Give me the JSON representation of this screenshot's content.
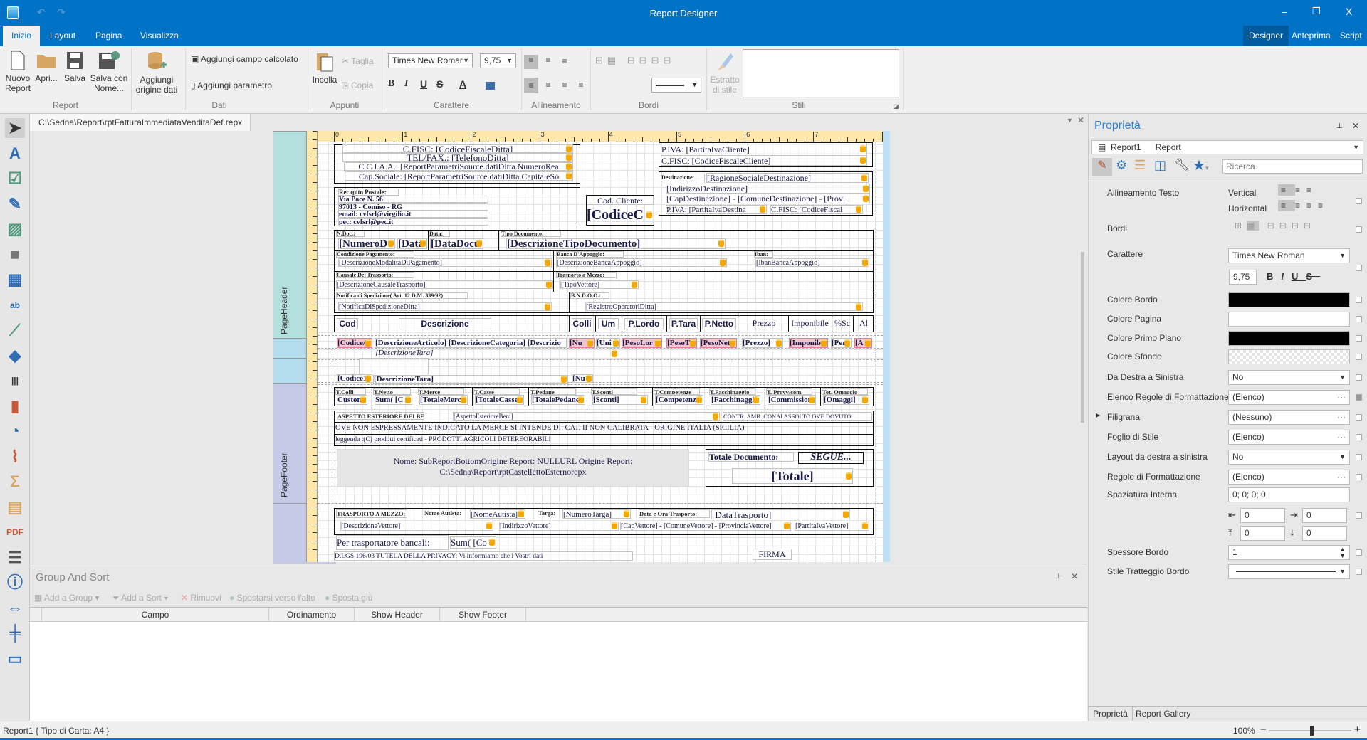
{
  "window": {
    "title": "Report Designer",
    "minimize": "–",
    "restore": "❐",
    "close": "X"
  },
  "ribbon_tabs": [
    {
      "label": "Inizio",
      "active": true
    },
    {
      "label": "Layout"
    },
    {
      "label": "Pagina"
    },
    {
      "label": "Visualizza"
    }
  ],
  "view_tabs": [
    {
      "label": "Designer",
      "active": true
    },
    {
      "label": "Anteprima"
    },
    {
      "label": "Script"
    }
  ],
  "ribbon": {
    "groups": [
      "Report",
      "Dati",
      "Appunti",
      "Carattere",
      "Allineamento",
      "Bordi",
      "Stili"
    ],
    "nuovo": "Nuovo Report",
    "apri": "Apri...",
    "salva": "Salva",
    "salva_con": "Salva con Nome...",
    "aggiungi_origine": "Aggiungi origine dati",
    "campo_calcolato": "Aggiungi campo calcolato",
    "parametro": "Aggiungi parametro",
    "incolla": "Incolla",
    "taglia": "Taglia",
    "copia": "Copia",
    "font": "Times New Romar",
    "size": "9,75",
    "bold": "B",
    "italic": "I",
    "underline": "U",
    "strike": "S",
    "forecolor": "A",
    "estratto": "Estratto di stile"
  },
  "document_tab": "C:\\Sedna\\Report\\rptFatturaImmediataVenditaDef.repx",
  "bands": {
    "page_header": "PageHeader",
    "page_footer": "PageFooter"
  },
  "ruler_marks": [
    "0",
    "1",
    "2",
    "3",
    "4",
    "5",
    "6",
    "7",
    "8"
  ],
  "report": {
    "h": {
      "cfisc": "C.FISC: [CodiceFiscaleDitta]",
      "tel": "TEL/FAX.: [TelefonoDitta]",
      "cciaa": "C.C.I.A.A.: [ReportParametriSource.datiDitta.NumeroRea",
      "capsoc": "Cap.Sociale: [ReportParametriSource.datiDitta.CapitaleSo",
      "recapito_label": "Recapito Postale:",
      "via": "Via Pace N. 56",
      "cap": "97013 - Comiso - RG",
      "email": "email: cvfsrl@virgilio.it",
      "pec": "pec: cvfsrl@pec.it",
      "codcli_label": "Cod. Cliente:",
      "codcli": "[CodiceC",
      "piva_cli": "P.IVA:  [PartitaIvaCliente]",
      "cfisc_cli": "C.FISC: [CodiceFiscaleCliente]",
      "dest_label": "Destinazione:",
      "dest_rag": "[RagioneSocialeDestinazione]",
      "dest_ind": "[IndirizzoDestinazione]",
      "dest_cap": "[CapDestinazione] - [ComuneDestinazione] - [Provi",
      "dest_piva": "P.IVA:  [PartitaIvaDestina",
      "dest_cf": "C.FISC: [CodiceFiscal"
    },
    "d": {
      "ndoc_label": "N.Doc.:",
      "ndoc": "[NumeroD",
      "data_a": "[Data",
      "data_label": "Data:",
      "data_b": "[DataDocu",
      "tipo_label": "Tipo Documento:",
      "tipo": "[DescrizioneTipoDocumento]",
      "cond_label": "Condizione Pagamento:",
      "cond": "[DescrizioneModalitaDiPagamento]",
      "banca_label": "Banca D'Appoggio:",
      "banca": "[DescrizioneBancaAppoggio]",
      "iban_label": "Iban:",
      "iban": "[IbanBancaAppoggio]",
      "causale_label": "Causale Del Trasporto:",
      "causale": "[DescrizioneCausaleTrasporto]",
      "tm_label": "Trasporto a Mezzo:",
      "tm": "[TipoVettore]",
      "notifica_label": "Notifica  di Spedizione( Art. 12 D.M. 339/92)",
      "notifica": "[NotificaDiSpedizioneDitta]",
      "bndoo_label": "B.N.D.O.O.:",
      "bndoo": "[RegistroOperatoriDitta]"
    },
    "columns": [
      "Cod",
      "Descrizione",
      "Colli",
      "Um",
      "P.Lordo",
      "P.Tara",
      "P.Netto",
      "Prezzo",
      "Imponibile",
      "%Sc",
      "Al"
    ],
    "detail": [
      "[Codice/",
      "[DescrizioneArticolo] [DescrizioneCategoria] [Descrizio",
      "[Nu",
      "[Uni",
      "[PesoLor",
      "[PesoT",
      "[PesoNet",
      "[Prezzo]",
      "[Imponib",
      "[Perc",
      "[A"
    ],
    "detail_tara": "[DescrizioneTara]",
    "detail2": [
      "[Codice1",
      "[DescrizioneTara]",
      "[Nu"
    ],
    "totals": [
      {
        "label": "T.Colli",
        "value": "Custom"
      },
      {
        "label": "T.Netto",
        "value": "Sum( [C"
      },
      {
        "label": "T.Merce",
        "value": "[TotaleMerce"
      },
      {
        "label": "T.Casse",
        "value": "[TotaleCasse"
      },
      {
        "label": "T.Pedane",
        "value": "[TotalePedane"
      },
      {
        "label": "T.Sconti",
        "value": "[Sconti]"
      },
      {
        "label": "T.Competenze",
        "value": "[Competenze"
      },
      {
        "label": "T.Facchinaggio",
        "value": "[Facchinaggio"
      },
      {
        "label": "T. Provv/com.",
        "value": "[Commission"
      },
      {
        "label": "Tot. Omaggio",
        "value": "[Omaggi]"
      }
    ],
    "f": {
      "aspetto_label": "ASPETTO ESTERIORE DEI BENI:",
      "aspetto": "[AspettoEsterioreBeni]",
      "conai": "CONTR. AMB. CONAI ASSOLTO OVE DOVUTO",
      "ove": "OVE NON ESPRESSAMENTE INDICATO LA MERCE SI INTENDE DI:  CAT. II NON CALIBRATA -  ORIGINE ITALIA (SICILIA)",
      "leggenda": "leggenda :(C) prodotti certificati -  PRODOTTI AGRICOLI DETEREORABILI",
      "sub1": "Nome: SubReportBottomOrigine Report: NULLURL Origine Report:",
      "sub2": "C:\\Sedna\\Report\\rptCastellettoEsternorepx",
      "totdoc_label": "Totale Documento:",
      "segue": "SEGUE...",
      "totale": "[Totale]",
      "tmz_label": "TRASPORTO A MEZZO:",
      "autista_label": "Nome Autista:",
      "autista": "[NomeAutista]",
      "targa_label": "Targa:",
      "targa": "[NumeroTarga]",
      "dataora_label": "Data e Ora Trasporto:",
      "datatr": "[DataTrasporto]",
      "vett": "[DescrizioneVettore]",
      "vett_ind": "[IndirizzoVettore]",
      "vett_cap": "[CapVettore] - [ComuneVettore] - [ProvinciaVettore]",
      "vett_piva": "[PartitaIvaVettore]",
      "per_trasp": "Per trasportatore bancali:",
      "sum": "Sum( [Co",
      "dlgs": "D.LGS 196/03 TUTELA DELLA PRIVACY: Vi informiamo che i Vostri dati",
      "firma": "FIRMA"
    }
  },
  "group_sort": {
    "title": "Group And Sort",
    "toolbar": [
      "Add a Group",
      "Add a Sort",
      "Rimuovi",
      "Spostarsi verso l'alto",
      "Sposta giù"
    ],
    "columns": [
      "Campo",
      "Ordinamento",
      "Show Header",
      "Show Footer"
    ]
  },
  "properties": {
    "title": "Proprietà",
    "object_name": "Report1",
    "object_type": "Report",
    "search_placeholder": "Ricerca",
    "rows": {
      "allineamento": "Allineamento Testo",
      "vertical": "Vertical",
      "horizontal": "Horizontal",
      "bordi": "Bordi",
      "carattere": "Carattere",
      "font": "Times New Roman",
      "size": "9,75",
      "colore_bordo": "Colore Bordo",
      "colore_pagina": "Colore Pagina",
      "colore_primo": "Colore Primo Piano",
      "colore_sfondo": "Colore Sfondo",
      "dds": "Da Destra a Sinistra",
      "dds_val": "No",
      "elenco": "Elenco Regole di Formattazione",
      "elenco_val": "(Elenco)",
      "filigrana": "Filigrana",
      "filigrana_val": "(Nessuno)",
      "foglio": "Foglio di Stile",
      "foglio_val": "(Elenco)",
      "layout": "Layout da destra a sinistra",
      "layout_val": "No",
      "regole": "Regole di Formattazione",
      "regole_val": "(Elenco)",
      "spaziatura": "Spaziatura Interna",
      "spaziatura_val": "0; 0; 0; 0",
      "pad_l": "0",
      "pad_r": "0",
      "pad_t": "0",
      "pad_b": "0",
      "spessore": "Spessore Bordo",
      "spessore_val": "1",
      "tratteggio": "Stile Tratteggio Bordo"
    },
    "colors": {
      "bordo": "#000000",
      "pagina": "#ffffff",
      "primo": "#000000"
    },
    "tabs": [
      "Proprietà",
      "Report Gallery"
    ]
  },
  "status": {
    "text": "Report1 { Tipo di Carta: A4 }",
    "zoom": "100%",
    "zoom_level": 100
  }
}
